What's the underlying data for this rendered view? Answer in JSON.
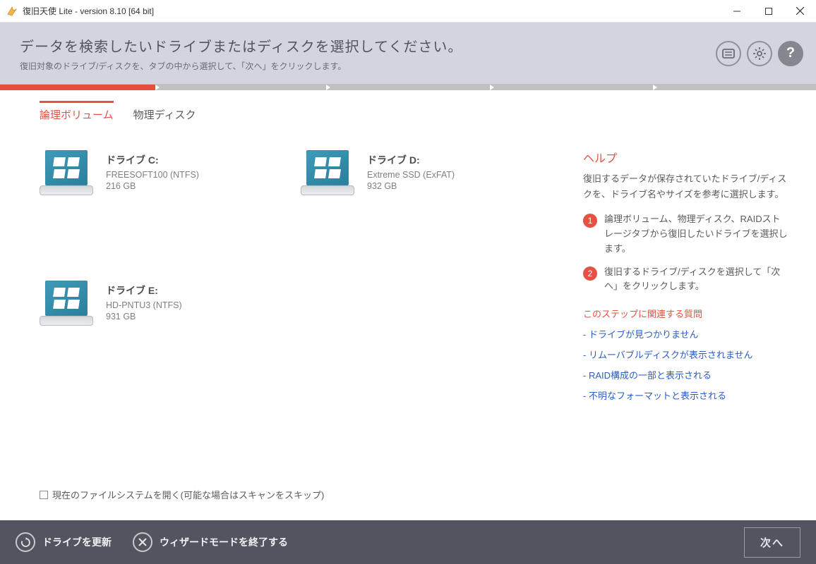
{
  "window": {
    "title": "復旧天使 Lite - version 8.10 [64 bit]"
  },
  "header": {
    "title": "データを検索したいドライブまたはディスクを選択してください。",
    "subtitle": "復旧対象のドライブ/ディスクを、タブの中から選択して、「次へ」をクリックします。"
  },
  "tabs": {
    "logical": "論理ボリューム",
    "physical": "物理ディスク"
  },
  "drives": [
    {
      "name": "ドライブ C:",
      "desc": "FREESOFT100 (NTFS)",
      "size": "216 GB"
    },
    {
      "name": "ドライブ D:",
      "desc": "Extreme SSD (ExFAT)",
      "size": "932 GB"
    },
    {
      "name": "ドライブ E:",
      "desc": "HD-PNTU3 (NTFS)",
      "size": "931 GB"
    }
  ],
  "help": {
    "title": "ヘルプ",
    "intro": "復旧するデータが保存されていたドライブ/ディスクを、ドライブ名やサイズを参考に選択します。",
    "steps": [
      "論理ボリューム、物理ディスク、RAIDストレージタブから復旧したいドライブを選択します。",
      "復旧するドライブ/ディスクを選択して「次へ」をクリックします。"
    ],
    "faq_title": "このステップに関連する質問",
    "faq": [
      "- ドライブが見つかりません",
      "- リムーバブルディスクが表示されません",
      "- RAID構成の一部と表示される",
      "- 不明なフォーマットと表示される"
    ]
  },
  "checkbox_label": "現在のファイルシステムを開く(可能な場合はスキャンをスキップ)",
  "footer": {
    "refresh": "ドライブを更新",
    "exit": "ウィザードモードを終了する",
    "next": "次へ"
  }
}
